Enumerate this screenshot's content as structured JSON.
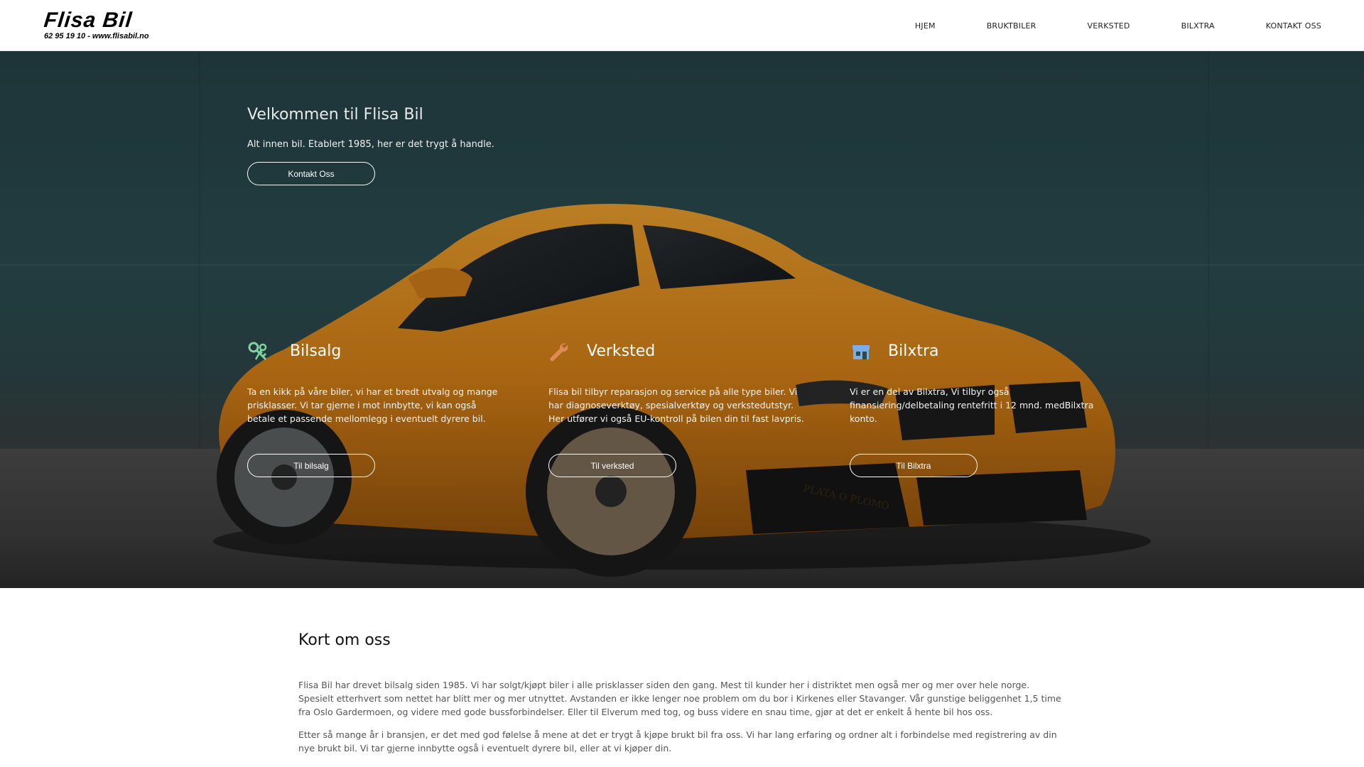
{
  "header": {
    "logo_title": "Flisa Bil",
    "logo_sub": "62 95 19 10 - www.flisabil.no",
    "nav": [
      "HJEM",
      "BRUKTBILER",
      "VERKSTED",
      "BILXTRA",
      "KONTAKT OSS"
    ]
  },
  "hero": {
    "title": "Velkommen til Flisa Bil",
    "subtitle": "Alt innen bil. Etablert 1985, her er det trygt å handle.",
    "cta": "Kontakt Oss",
    "cards": [
      {
        "icon": "car-keys-icon",
        "title": "Bilsalg",
        "text": "Ta en kikk på våre biler, vi har et bredt utvalg og mange prisklasser. Vi tar gjerne i mot innbytte, vi kan også betale et passende mellomlegg i eventuelt dyrere bil.",
        "button": "Til bilsalg"
      },
      {
        "icon": "wrench-icon",
        "title": "Verksted",
        "text": "Flisa bil tilbyr reparasjon og service på alle type biler. Vi har diagnoseverktøy, spesialverktøy og verkstedutstyr. Her utfører vi også EU-kontroll på bilen din til fast lavpris.",
        "button": "Til verksted"
      },
      {
        "icon": "store-icon",
        "title": "Bilxtra",
        "text": "Vi er en del av Bilxtra, Vi tilbyr også finansiering/delbetaling rentefritt i 12 mnd. medBilxtra konto.",
        "button": "Til Bilxtra"
      }
    ],
    "car_plate_text": "PLATA O PLOMO"
  },
  "about": {
    "title": "Kort om oss",
    "paragraphs": [
      "Flisa Bil har drevet bilsalg siden 1985. Vi har solgt/kjøpt biler i alle prisklasser siden den gang. Mest til kunder her i distriktet men også mer og mer over hele norge. Spesielt etterhvert som nettet har blitt mer og mer utnyttet. Avstanden er ikke lenger noe problem om du bor i Kirkenes eller Stavanger. Vår gunstige beliggenhet 1,5 time fra Oslo Gardermoen, og videre med gode bussforbindelser. Eller til Elverum med tog, og buss videre en snau time, gjør at det er enkelt å hente bil hos oss.",
      "Etter så mange år i bransjen, er det med god følelse å mene at det er trygt å kjøpe brukt bil fra oss. Vi har lang erfaring og ordner alt i forbindelse med registrering av din nye brukt bil. Vi tar gjerne innbytte også i eventuelt dyrere bil, eller at vi kjøper din."
    ]
  },
  "colors": {
    "hero_teal": "#2a4a4e",
    "car_orange": "#d9801a",
    "icon_green": "#7fd3a0",
    "icon_orange": "#e08a5a",
    "icon_blue": "#7aaee8"
  }
}
